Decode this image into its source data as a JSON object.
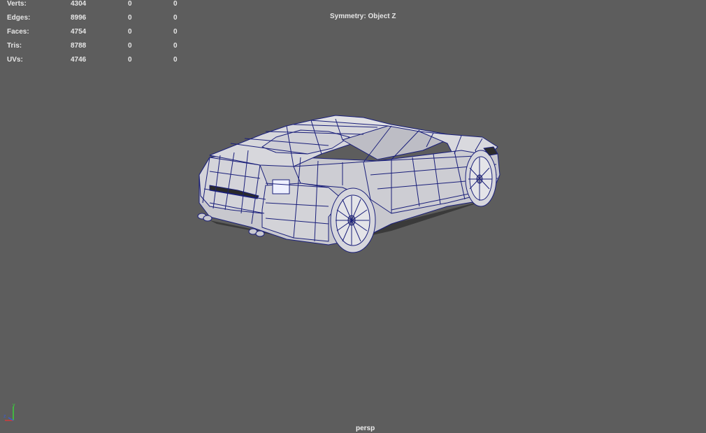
{
  "heads_up": {
    "rows": [
      {
        "label": "Verts:",
        "total": "4304",
        "selected": "0",
        "component": "0"
      },
      {
        "label": "Edges:",
        "total": "8996",
        "selected": "0",
        "component": "0"
      },
      {
        "label": "Faces:",
        "total": "4754",
        "selected": "0",
        "component": "0"
      },
      {
        "label": "Tris:",
        "total": "8788",
        "selected": "0",
        "component": "0"
      },
      {
        "label": "UVs:",
        "total": "4746",
        "selected": "0",
        "component": "0"
      }
    ]
  },
  "symmetry": {
    "label": "Symmetry: Object Z"
  },
  "camera": {
    "name": "persp"
  },
  "axis_indicator": {
    "y_label": "y",
    "z_label": "z"
  },
  "colors": {
    "viewport_bg": "#5d5d5d",
    "wireframe": "#1a1f7a",
    "surface": "#d7d7dc",
    "axis_x": "#d23b3b",
    "axis_y": "#3bd23b",
    "axis_z": "#3b5ad2"
  }
}
